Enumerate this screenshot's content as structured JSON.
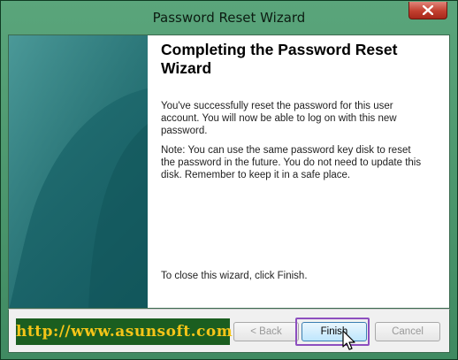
{
  "window": {
    "title": "Password Reset Wizard"
  },
  "content": {
    "heading": "Completing the Password Reset Wizard",
    "paragraph1": "You've successfully reset the password for this user account. You will now be able to log on with this new password.",
    "paragraph2": "Note: You can use the same password key disk to reset the password in the future. You do not need to update this disk. Remember to keep it in a safe place.",
    "close_hint": "To close this wizard, click Finish."
  },
  "footer": {
    "brand_url": "http://www.asunsoft.com",
    "back_label": "< Back",
    "finish_label": "Finish",
    "cancel_label": "Cancel"
  },
  "colors": {
    "frame": "#4f9a70",
    "banner": "#1f6a6e",
    "brand_bg": "#1b5e20",
    "brand_text": "#f5c518",
    "highlight": "#8d4fbf"
  },
  "icons": {
    "close": "close-icon",
    "cursor": "mouse-pointer-icon"
  }
}
